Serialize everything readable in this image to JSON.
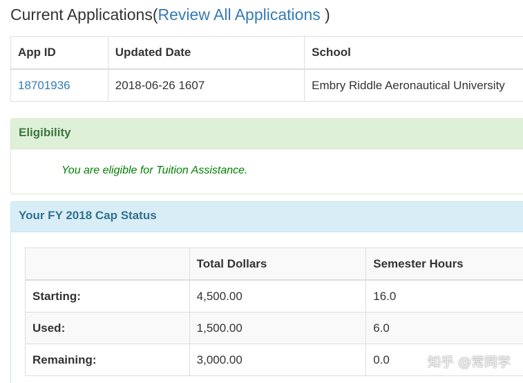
{
  "header": {
    "title_prefix": "Current Applications(",
    "review_link": "Review All Applications",
    "title_suffix": " )"
  },
  "applications_table": {
    "columns": [
      "App ID",
      "Updated Date",
      "School"
    ],
    "rows": [
      {
        "app_id": "18701936",
        "updated_date": "2018-06-26 1607",
        "school": "Embry Riddle Aeronautical University"
      }
    ]
  },
  "eligibility": {
    "title": "Eligibility",
    "message": "You are eligible for Tuition Assistance."
  },
  "cap_status": {
    "title": "Your FY 2018 Cap Status",
    "columns": [
      "",
      "Total Dollars",
      "Semester Hours"
    ],
    "rows": [
      {
        "label": "Starting:",
        "dollars": "4,500.00",
        "hours": "16.0"
      },
      {
        "label": "Used:",
        "dollars": "1,500.00",
        "hours": "6.0"
      },
      {
        "label": "Remaining:",
        "dollars": "3,000.00",
        "hours": "0.0"
      }
    ]
  },
  "watermark": "知乎 @常同学",
  "colors": {
    "link": "#337ab7",
    "success_bg": "#dff0d8",
    "success_text": "#3c763d",
    "info_bg": "#d9edf7",
    "info_text": "#31708f",
    "eligible_text": "#008000"
  }
}
